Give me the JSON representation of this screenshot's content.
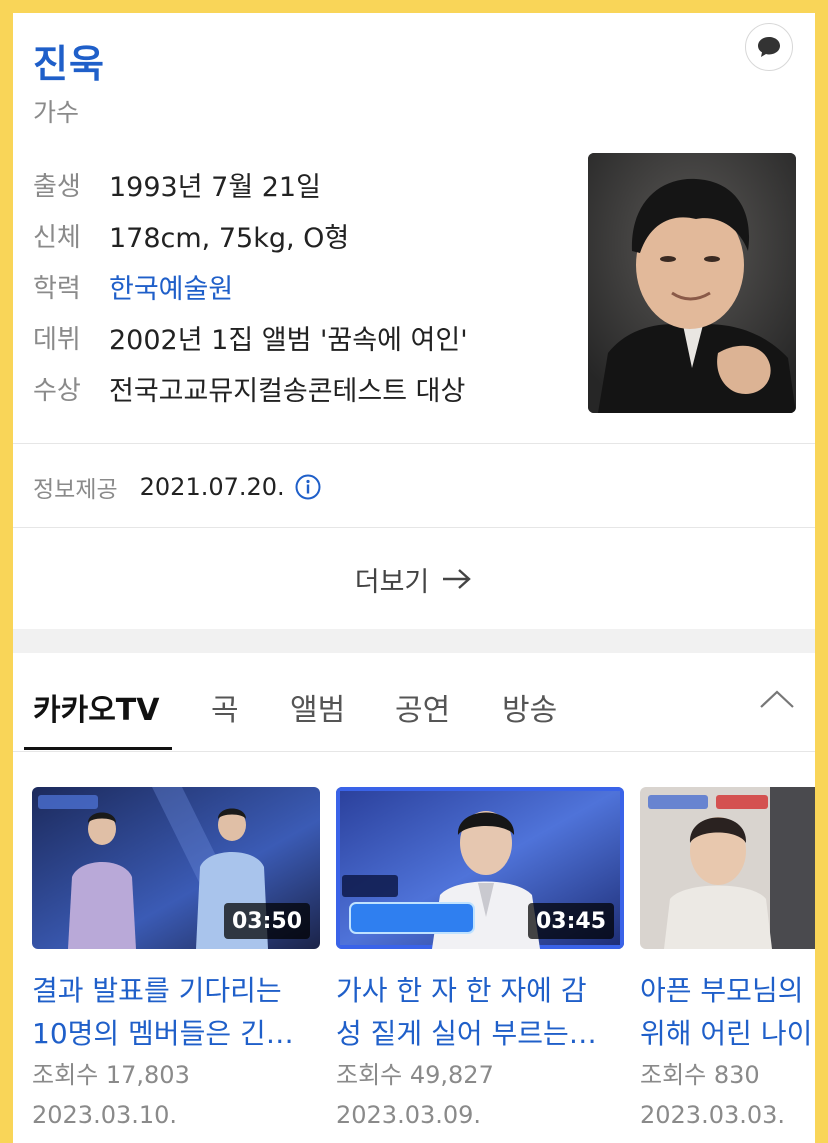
{
  "profile": {
    "name": "진욱",
    "occupation": "가수",
    "info": [
      {
        "label": "출생",
        "value": "1993년 7월 21일",
        "is_link": false
      },
      {
        "label": "신체",
        "value": "178cm, 75kg, O형",
        "is_link": false
      },
      {
        "label": "학력",
        "value": "한국예술원",
        "is_link": true
      },
      {
        "label": "데뷔",
        "value": "2002년 1집 앨범 '꿈속에 여인'",
        "is_link": false
      },
      {
        "label": "수상",
        "value": "전국고교뮤지컬송콘테스트 대상",
        "is_link": false
      }
    ],
    "photo_icon": "person-photo"
  },
  "source": {
    "label": "정보제공",
    "date": "2021.07.20."
  },
  "more": {
    "label": "더보기"
  },
  "tabs": [
    {
      "label": "카카오TV",
      "active": true
    },
    {
      "label": "곡",
      "active": false
    },
    {
      "label": "앨범",
      "active": false
    },
    {
      "label": "공연",
      "active": false
    },
    {
      "label": "방송",
      "active": false
    }
  ],
  "videos": [
    {
      "title_lines": [
        "결과 발표를 기다리는",
        "10명의 멤버들은 긴…"
      ],
      "views": "조회수 17,803",
      "date": "2023.03.10.",
      "duration": "03:50"
    },
    {
      "title_lines": [
        "가사 한 자 한 자에 감",
        "성 짙게 실어 부르는…"
      ],
      "views": "조회수 49,827",
      "date": "2023.03.09.",
      "duration": "03:45"
    },
    {
      "title_lines": [
        "아픈 부모님의",
        "위해 어린 나이"
      ],
      "views": "조회수 830",
      "date": "2023.03.03.",
      "duration": ""
    }
  ],
  "colors": {
    "accent": "#1f5fc9",
    "frame": "#f9d558"
  }
}
